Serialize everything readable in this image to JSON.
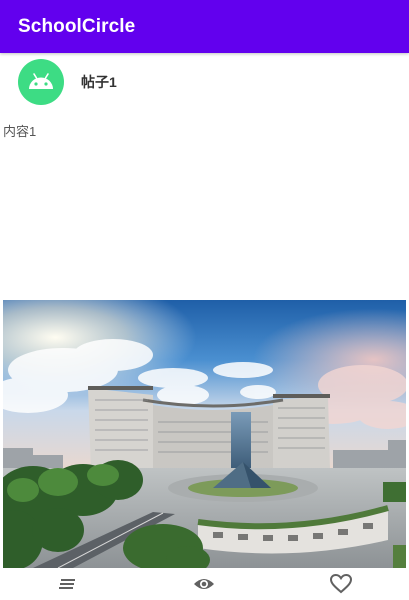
{
  "app": {
    "title": "SchoolCircle",
    "accent_color": "#6200ee"
  },
  "post": {
    "title": "帖子1",
    "content": "内容1",
    "avatar_icon": "android-icon",
    "image": "campus-building-photo"
  },
  "bottom_bar": {
    "items": [
      {
        "icon": "menu-lines-icon"
      },
      {
        "icon": "eye-icon"
      },
      {
        "icon": "heart-icon"
      }
    ]
  }
}
